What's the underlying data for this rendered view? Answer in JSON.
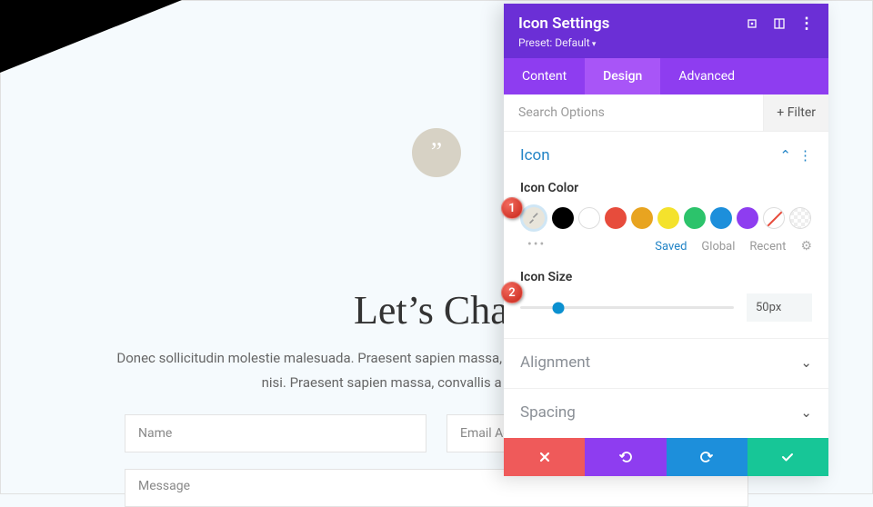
{
  "page": {
    "heading": "Let’s Chat",
    "subtext": "Donec sollicitudin molestie malesuada. Praesent sapien massa, convallis a pellentesque nec, egestas non nisi. Praesent sapien massa, convallis a pellentesque nec.",
    "name_ph": "Name",
    "email_ph": "Email Address",
    "message_ph": "Message",
    "quote_glyph": "”"
  },
  "panel": {
    "title": "Icon Settings",
    "preset": "Preset: Default",
    "tabs": [
      "Content",
      "Design",
      "Advanced"
    ],
    "active_tab": 1,
    "search_ph": "Search Options",
    "filter_label": "+  Filter",
    "sections": {
      "icon": {
        "title": "Icon",
        "open": true
      },
      "alignment": {
        "title": "Alignment"
      },
      "spacing": {
        "title": "Spacing"
      }
    },
    "icon_color_label": "Icon Color",
    "palette_tabs": [
      "Saved",
      "Global",
      "Recent"
    ],
    "palette_active": 0,
    "swatches": [
      "eyedrop",
      "#000000",
      "#ffffff",
      "#e74c3c",
      "#e8a420",
      "#f4e22c",
      "#2cc36b",
      "#1d8fdb",
      "#8e3df0",
      "none",
      "trans"
    ],
    "icon_size_label": "Icon Size",
    "icon_size_value": "50px"
  },
  "annotations": {
    "1": "1",
    "2": "2"
  }
}
